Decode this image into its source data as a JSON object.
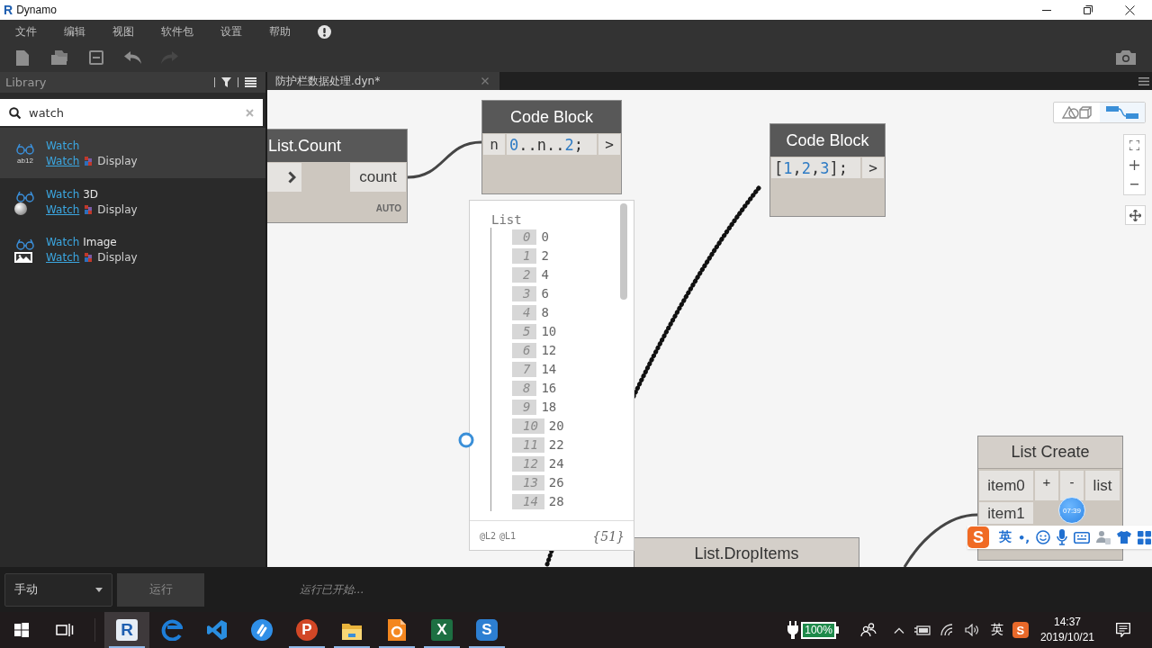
{
  "window": {
    "logo": "R",
    "title": "Dynamo"
  },
  "menu": [
    {
      "label": "文件"
    },
    {
      "label": "编辑"
    },
    {
      "label": "视图"
    },
    {
      "label": "软件包"
    },
    {
      "label": "设置"
    },
    {
      "label": "帮助"
    }
  ],
  "toolbar": [
    {
      "kind": "new",
      "disabled": false
    },
    {
      "kind": "open",
      "disabled": false
    },
    {
      "kind": "save",
      "disabled": false
    },
    {
      "kind": "undo",
      "disabled": false
    },
    {
      "kind": "redo",
      "disabled": true
    }
  ],
  "library": {
    "title": "Library",
    "search": {
      "value": "watch"
    },
    "results": [
      {
        "kind": "watch",
        "icon_text": "ab12",
        "match": "Watch",
        "category": "Watch",
        "group": "Display",
        "selected": true
      },
      {
        "kind": "watch3d",
        "match": "Watch",
        "rest": "3D",
        "category": "Watch",
        "group": "Display",
        "selected": false
      },
      {
        "kind": "image",
        "match": "Watch",
        "rest": "Image",
        "category": "Watch",
        "group": "Display",
        "selected": false
      }
    ]
  },
  "tabs": [
    {
      "label": "防护栏数据处理.dyn*",
      "selected": true
    }
  ],
  "view_toggle": [
    {
      "kind": "geometry",
      "selected": false
    },
    {
      "kind": "graph",
      "selected": true
    }
  ],
  "nodes": [
    {
      "kind": "function",
      "title": "List.Count",
      "preview": true,
      "inputs": [
        {
          "kind": "arrow"
        }
      ],
      "outputs": [
        {
          "label": "count"
        }
      ],
      "lacing": "AUTO"
    },
    {
      "kind": "code",
      "title": "Code Block",
      "preview": true,
      "inputs": [
        {
          "label": "n"
        }
      ],
      "code": [
        {
          "text": "0",
          "kind": "number"
        },
        {
          "text": "..n..",
          "kind": "plain"
        },
        {
          "text": "2",
          "kind": "number"
        },
        {
          "text": ";",
          "kind": "plain"
        }
      ],
      "outputs": [
        {
          "label": ">"
        }
      ]
    },
    {
      "kind": "code",
      "title": "Code Block",
      "preview": true,
      "code": [
        {
          "text": "[",
          "kind": "plain"
        },
        {
          "text": "1",
          "kind": "number"
        },
        {
          "text": ",",
          "kind": "plain"
        },
        {
          "text": "2",
          "kind": "number"
        },
        {
          "text": ",",
          "kind": "plain"
        },
        {
          "text": "3",
          "kind": "number"
        },
        {
          "text": "];",
          "kind": "plain"
        }
      ],
      "outputs": [
        {
          "label": ">"
        }
      ]
    },
    {
      "kind": "listcreate",
      "title": "List Create",
      "preview": false,
      "inputs": [
        {
          "label": "item0"
        },
        {
          "label": "item1"
        }
      ],
      "buttons": [
        "+",
        "-"
      ],
      "outputs": [
        {
          "label": "list"
        }
      ]
    },
    {
      "kind": "function",
      "title": "List.DropItems",
      "preview": false
    }
  ],
  "preview": {
    "label": "List",
    "items": [
      {
        "index": "0",
        "value": "0"
      },
      {
        "index": "1",
        "value": "2"
      },
      {
        "index": "2",
        "value": "4"
      },
      {
        "index": "3",
        "value": "6"
      },
      {
        "index": "4",
        "value": "8"
      },
      {
        "index": "5",
        "value": "10"
      },
      {
        "index": "6",
        "value": "12"
      },
      {
        "index": "7",
        "value": "14"
      },
      {
        "index": "8",
        "value": "16"
      },
      {
        "index": "9",
        "value": "18"
      },
      {
        "index": "10",
        "value": "20"
      },
      {
        "index": "11",
        "value": "22"
      },
      {
        "index": "12",
        "value": "24"
      },
      {
        "index": "13",
        "value": "26"
      },
      {
        "index": "14",
        "value": "28"
      }
    ],
    "levels": [
      "@L2",
      "@L1"
    ],
    "count": "{51}"
  },
  "recorder_timer": "07:39",
  "ime_bar": {
    "logo": "S",
    "language": "英",
    "punctuation": "•,"
  },
  "run": {
    "mode": "手动",
    "button": {
      "label": "运行",
      "disabled": true
    },
    "status": "运行已开始..."
  },
  "taskbar": {
    "apps": [
      {
        "kind": "revit",
        "glyph": "R",
        "selected": true,
        "running": true
      },
      {
        "kind": "edge",
        "selected": false,
        "running": false
      },
      {
        "kind": "vscode",
        "selected": false,
        "running": false
      },
      {
        "kind": "bluecircle",
        "selected": false,
        "running": false
      },
      {
        "kind": "powerpoint",
        "glyph": "P",
        "selected": false,
        "running": true
      },
      {
        "kind": "explorer",
        "selected": false,
        "running": true
      },
      {
        "kind": "pdf",
        "selected": false,
        "running": true
      },
      {
        "kind": "excel",
        "glyph": "X",
        "selected": false,
        "running": true
      },
      {
        "kind": "snagit",
        "glyph": "S",
        "selected": false,
        "running": true
      }
    ],
    "tray": {
      "battery": "100%",
      "language": "英",
      "logo": "S",
      "time": "14:37",
      "date": "2019/10/21"
    }
  }
}
